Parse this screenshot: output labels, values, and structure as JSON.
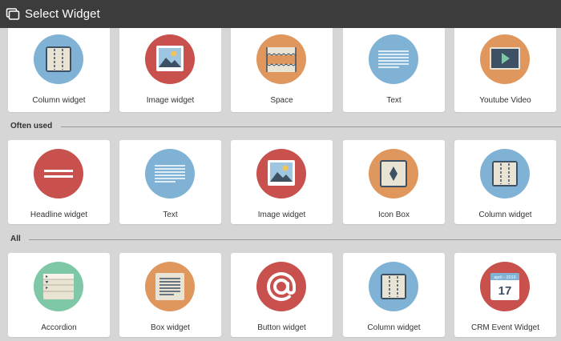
{
  "titlebar": {
    "title": "Select Widget",
    "icon": "window-icon"
  },
  "colors": {
    "blue": "#7fb2d4",
    "red": "#c8514e",
    "orange": "#e0975e",
    "green": "#7ec7a7",
    "titlebar": "#3c3c3c",
    "background": "#d6d6d6"
  },
  "recent": [
    {
      "label": "Column widget",
      "icon": "column-icon"
    },
    {
      "label": "Image widget",
      "icon": "image-icon"
    },
    {
      "label": "Space",
      "icon": "space-icon"
    },
    {
      "label": "Text",
      "icon": "text-icon"
    },
    {
      "label": "Youtube Video",
      "icon": "video-icon"
    }
  ],
  "sections": {
    "often_used": "Often used",
    "all": "All"
  },
  "often_used": [
    {
      "label": "Headline widget",
      "icon": "headline-icon"
    },
    {
      "label": "Text",
      "icon": "text-icon"
    },
    {
      "label": "Image widget",
      "icon": "image-icon"
    },
    {
      "label": "Icon Box",
      "icon": "icon-box-icon"
    },
    {
      "label": "Column widget",
      "icon": "column-icon"
    }
  ],
  "all": [
    {
      "label": "Accordion",
      "icon": "accordion-icon"
    },
    {
      "label": "Box widget",
      "icon": "box-icon"
    },
    {
      "label": "Button widget",
      "icon": "at-sign-icon"
    },
    {
      "label": "Column widget",
      "icon": "column-icon"
    },
    {
      "label": "CRM Event Widget",
      "icon": "calendar-icon",
      "calendar_month": "april - 2016",
      "calendar_day": "17"
    }
  ]
}
